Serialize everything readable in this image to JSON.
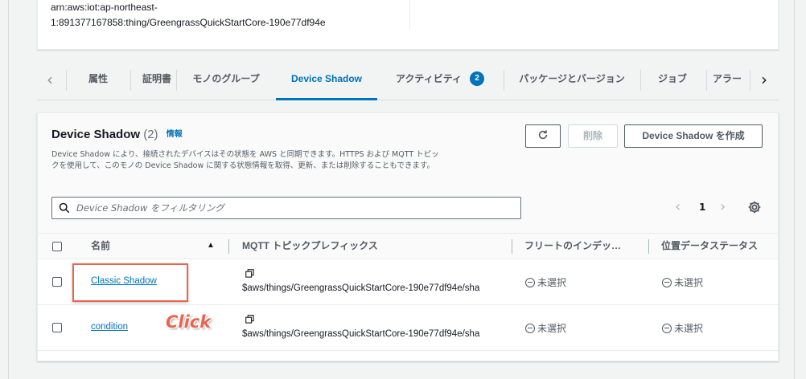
{
  "info": {
    "arn_line1": "arn:aws:iot:ap-northeast-",
    "arn_line2": "1:891377167858:thing/GreengrassQuickStartCore-190e77df94e"
  },
  "tabs": [
    {
      "label": "属性"
    },
    {
      "label": "証明書"
    },
    {
      "label": "モノのグループ"
    },
    {
      "label": "Device Shadow"
    },
    {
      "label": "アクティビティ",
      "badge": "2"
    },
    {
      "label": "パッケージとバージョン"
    },
    {
      "label": "ジョブ"
    },
    {
      "label": "アラー"
    }
  ],
  "panel": {
    "title": "Device Shadow",
    "count": "(2)",
    "info_link": "情報",
    "description": "Device Shadow により、接続されたデバイスはその状態を AWS と同期できます。HTTPS および MQTT トピックを使用して、このモノの Device Shadow に関する状態情報を取得、更新、または削除することもできます。",
    "delete_label": "削除",
    "create_label": "Device Shadow を作成",
    "filter_placeholder": "Device Shadow をフィルタリング",
    "page": "1"
  },
  "table": {
    "headers": {
      "name": "名前",
      "topic": "MQTT トピックプレフィックス",
      "fleet": "フリートのインデッ…",
      "location": "位置データステータス"
    },
    "rows": [
      {
        "name": "Classic Shadow",
        "topic": "$aws/things/GreengrassQuickStartCore-190e77df94e/sha",
        "fleet": "未選択",
        "location": "未選択"
      },
      {
        "name": "condition",
        "topic": "$aws/things/GreengrassQuickStartCore-190e77df94e/sha",
        "fleet": "未選択",
        "location": "未選択"
      }
    ]
  },
  "annotation": {
    "click_label": "Click",
    "color": "#e8654f"
  },
  "colors": {
    "accent": "#0073bb",
    "text": "#16191f",
    "muted": "#545b64"
  }
}
